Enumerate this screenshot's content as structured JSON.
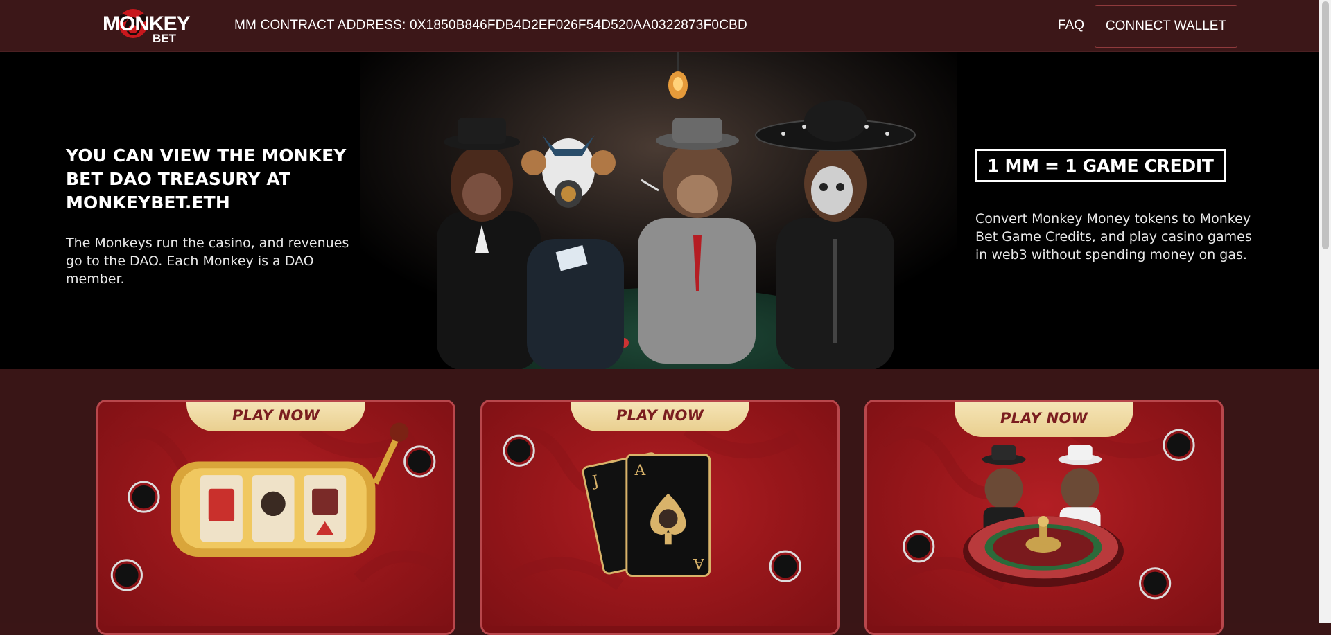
{
  "header": {
    "logo_text_top": "MONKEY",
    "logo_text_bottom": "BET",
    "contract_label": "MM CONTRACT ADDRESS: 0X1850B846FDB4D2EF026F54D520AA0322873F0CBD",
    "faq_label": "FAQ",
    "connect_label": "CONNECT WALLET"
  },
  "hero": {
    "left_heading": "YOU CAN VIEW THE MONKEY BET DAO TREASURY AT MONKEYBET.ETH",
    "left_text": "The Monkeys run the casino, and revenues go to the DAO. Each Monkey is a DAO member.",
    "credit_label": "1 MM =  1 GAME CREDIT",
    "right_text": "Convert Monkey Money tokens to Monkey Bet Game Credits, and play casino games in web3 without spending money on gas."
  },
  "games": [
    {
      "play_label": "PLAY NOW",
      "art": "slot-machine-icon"
    },
    {
      "play_label": "PLAY NOW",
      "art": "blackjack-cards-icon"
    },
    {
      "play_label": "PLAY NOW",
      "art": "roulette-wheel-icon"
    }
  ],
  "colors": {
    "header_bg": "#3c1718",
    "page_bg": "#391516",
    "card_red": "#9a171b",
    "card_border": "#b8474c",
    "tab_gold": "#f6e6b9",
    "tab_text": "#7a1d1f"
  }
}
